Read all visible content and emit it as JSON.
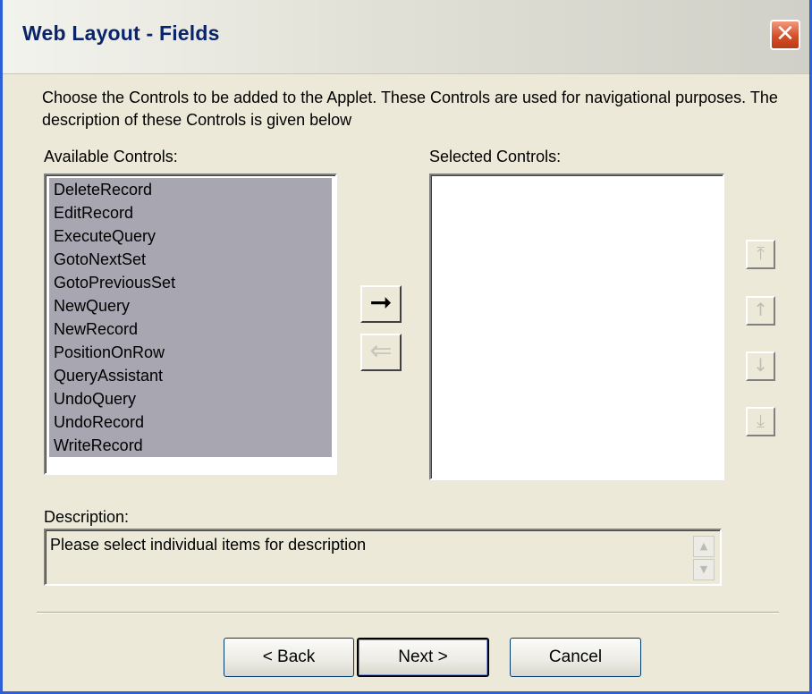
{
  "window": {
    "title": "Web Layout - Fields",
    "close_glyph": "✕"
  },
  "instructions": "Choose the Controls to be added to the Applet. These Controls are used for navigational purposes. The description of these Controls is given below",
  "available": {
    "label": "Available Controls:",
    "items": [
      "DeleteRecord",
      "EditRecord",
      "ExecuteQuery",
      "GotoNextSet",
      "GotoPreviousSet",
      "NewQuery",
      "NewRecord",
      "PositionOnRow",
      "QueryAssistant",
      "UndoQuery",
      "UndoRecord",
      "WriteRecord"
    ]
  },
  "selected": {
    "label": "Selected Controls:",
    "items": []
  },
  "transfer": {
    "add_glyph": "➞",
    "remove_glyph": "⇐"
  },
  "ordering": {
    "top_glyph": "⤒",
    "up_glyph": "↑",
    "down_glyph": "↓",
    "bottom_glyph": "⤓"
  },
  "description": {
    "label": "Description:",
    "text": "Please select individual items for description",
    "scroll_up_glyph": "▲",
    "scroll_down_glyph": "▼"
  },
  "buttons": {
    "back": "< Back",
    "next": "Next >",
    "cancel": "Cancel"
  },
  "colors": {
    "title_text": "#0a246a",
    "window_border": "#2d5fd6",
    "list_selection": "#a8a6b0",
    "dialog_background": "#ece9d8",
    "close_button": "#d4502a"
  }
}
